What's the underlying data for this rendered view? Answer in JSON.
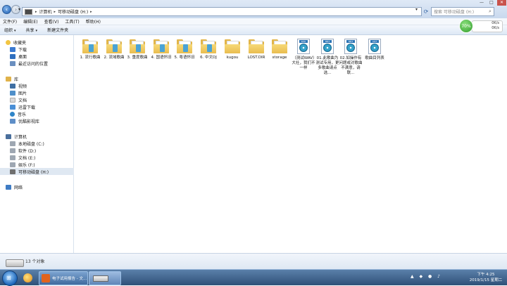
{
  "address": {
    "history": "▾",
    "crumbs": [
      "计算机",
      "可移动磁盘 (H:)"
    ],
    "search_placeholder": "搜索 可移动磁盘 (H:)"
  },
  "window_controls": {
    "minimize": "—",
    "maximize": "□",
    "close": "✕"
  },
  "menu": [
    "文件(F)",
    "编辑(E)",
    "查看(V)",
    "工具(T)",
    "帮助(H)"
  ],
  "toolbar": {
    "organize": "组织",
    "share": "共享",
    "new_folder": "新建文件夹"
  },
  "sidebar": {
    "favorites": {
      "label": "收藏夹",
      "items": [
        "下载",
        "桌面",
        "最近访问的位置"
      ]
    },
    "libraries": {
      "label": "库",
      "items": [
        "视频",
        "图片",
        "文档",
        "迅雷下载",
        "音乐",
        "优酷影视库"
      ]
    },
    "computer": {
      "label": "计算机",
      "items": [
        "本地磁盘 (C:)",
        "软件 (D:)",
        "文档 (E:)",
        "娱乐 (F:)",
        "可移动磁盘 (H:)"
      ]
    },
    "network": {
      "label": "网络"
    }
  },
  "files": [
    {
      "name": "1. 流行歌曲",
      "type": "folder"
    },
    {
      "name": "2. 流域歌曲",
      "type": "folder"
    },
    {
      "name": "3. 重度歌曲",
      "type": "folder"
    },
    {
      "name": "4. 国语怀旧",
      "type": "folder"
    },
    {
      "name": "5. 粤语怀旧",
      "type": "folder"
    },
    {
      "name": "6. 中文DJ",
      "type": "folder"
    },
    {
      "name": "kugou",
      "type": "folder"
    },
    {
      "name": "LOST.DIR",
      "type": "folder"
    },
    {
      "name": "storage",
      "type": "folder"
    },
    {
      "name": "（测试WAV）大社，我们不一样",
      "type": "wav",
      "tag": "WAV"
    },
    {
      "name": "01.此歌曲为测试专用，更多歌曲请点选...",
      "type": "wav",
      "tag": "MP3"
    },
    {
      "name": "02.如操作有问题或对歌曲不满意，请联...",
      "type": "wav",
      "tag": "MP3"
    },
    {
      "name": "歌曲目列表",
      "type": "wav",
      "tag": "LIST"
    }
  ],
  "details": {
    "count": "13 个对象"
  },
  "taskbar": {
    "app_label": "电子试用报告 - 文...",
    "tray": "▲ ◆ ● ♪",
    "time": "下午 4:25",
    "date": "2019/1/15 星期二"
  },
  "monitor": {
    "percent": "70%",
    "up": "0K/s",
    "down": "0K/s"
  }
}
